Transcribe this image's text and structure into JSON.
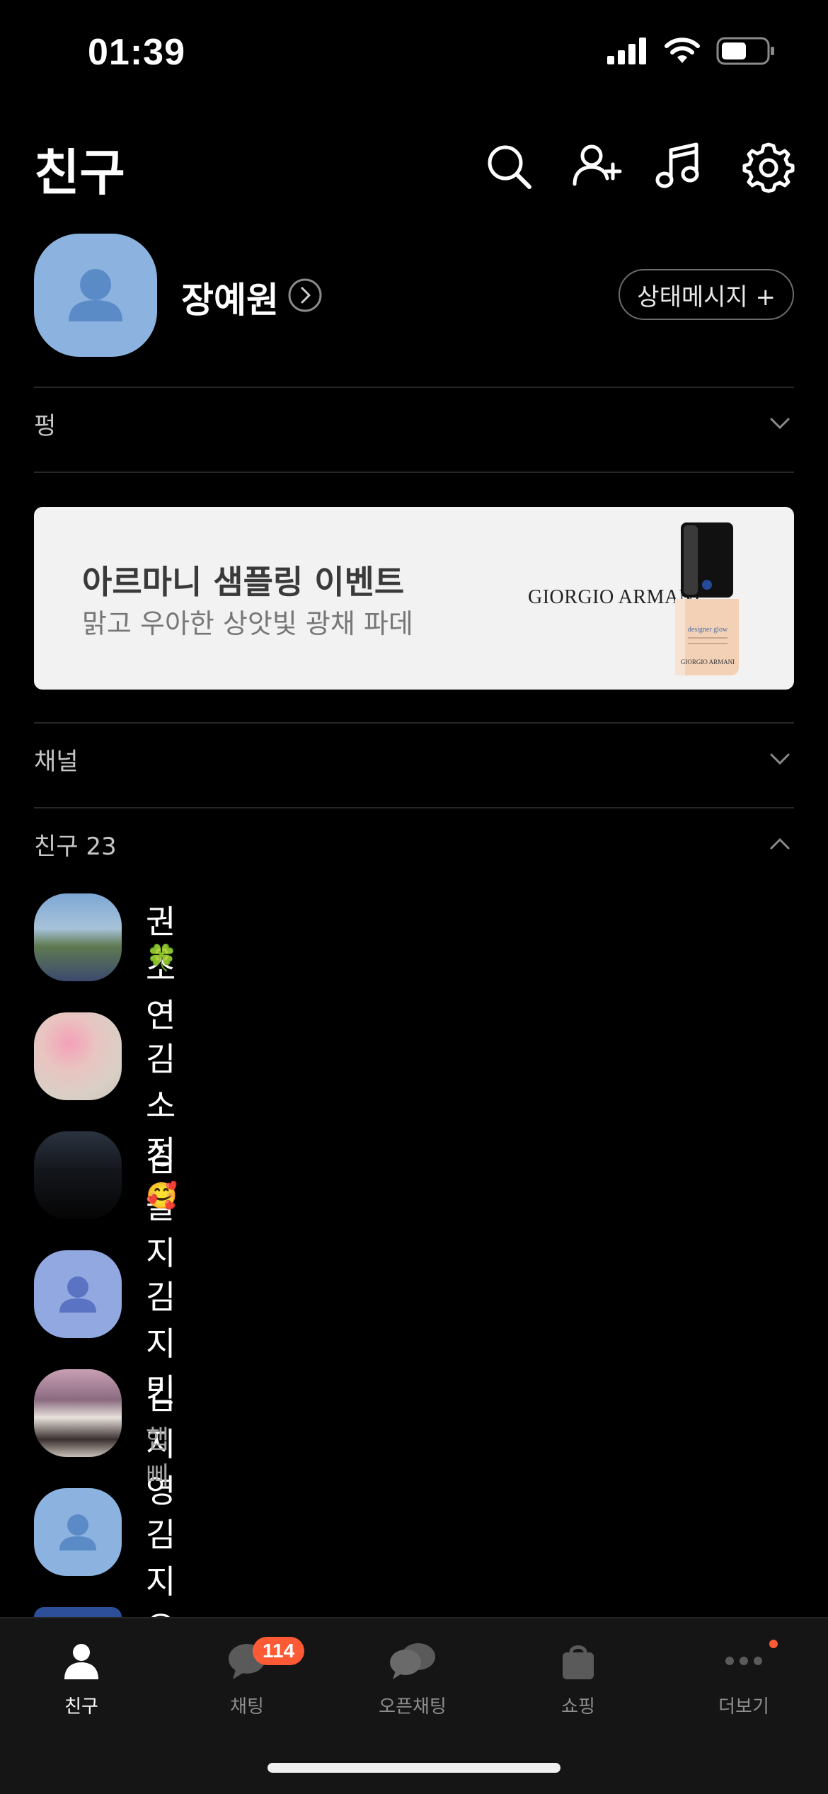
{
  "status_bar": {
    "time": "01:39"
  },
  "header": {
    "title": "친구",
    "icons": [
      "search-icon",
      "add-friend-icon",
      "music-icon",
      "settings-icon"
    ]
  },
  "profile": {
    "name": "장예원",
    "status_button": "상태메시지 +"
  },
  "sections": {
    "pung": "펑",
    "channel": "채널",
    "friends": "친구 23"
  },
  "banner": {
    "title": "아르마니 샘플링 이벤트",
    "subtitle": "맑고 우아한 상앗빛 광채 파데",
    "brand": "GIORGIO ARMANI"
  },
  "friends": [
    {
      "name": "권소연",
      "status": "🍀"
    },
    {
      "name": "김소정",
      "status": ""
    },
    {
      "name": "김솔지",
      "status": "🥰"
    },
    {
      "name": "김지민",
      "status": ""
    },
    {
      "name": "김지영",
      "status": "햅삐"
    },
    {
      "name": "김지유",
      "status": ""
    }
  ],
  "tabs": [
    {
      "label": "친구",
      "active": true
    },
    {
      "label": "채팅",
      "badge": "114"
    },
    {
      "label": "오픈채팅"
    },
    {
      "label": "쇼핑"
    },
    {
      "label": "더보기"
    }
  ],
  "colors": {
    "accent_badge": "#ff5a36",
    "default_avatar": "#8cb3e0",
    "background": "#000000"
  }
}
